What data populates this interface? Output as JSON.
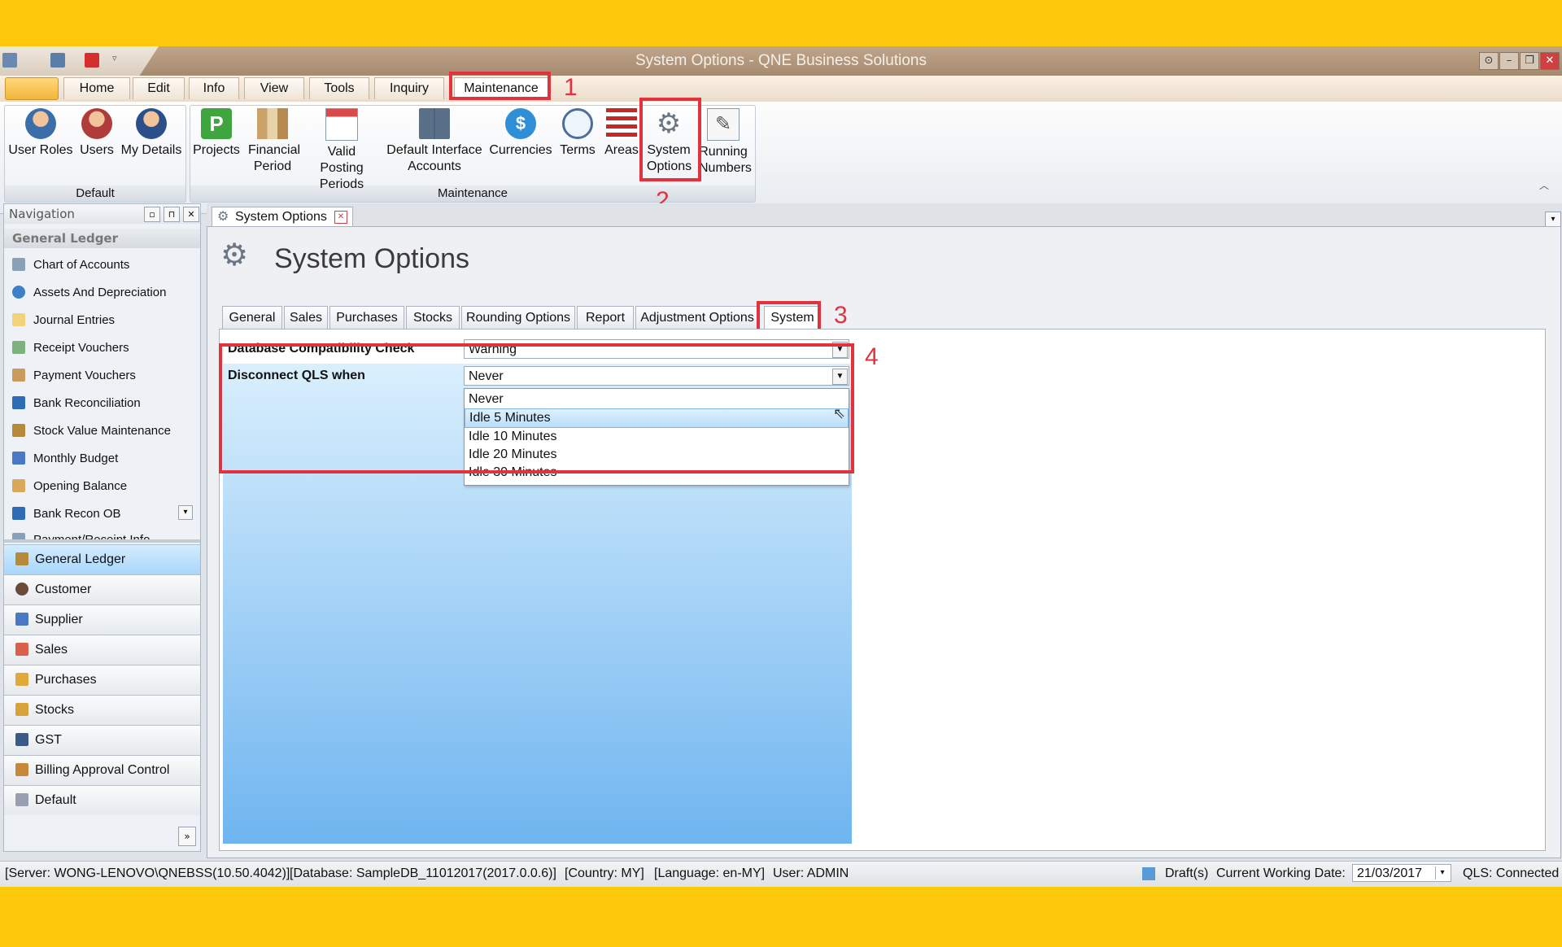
{
  "window": {
    "title": "System Options - QNE Business Solutions"
  },
  "menu": {
    "tabs": [
      "Home",
      "Edit",
      "Info",
      "View",
      "Tools",
      "Inquiry",
      "Maintenance"
    ],
    "active": "Maintenance"
  },
  "ribbon": {
    "default_group": {
      "label": "Default",
      "buttons": [
        "User Roles",
        "Users",
        "My Details"
      ]
    },
    "maintenance_group": {
      "label": "Maintenance",
      "buttons": [
        "Projects",
        "Financial Period",
        "Valid Posting Periods",
        "Default Interface Accounts",
        "Currencies",
        "Terms",
        "Areas",
        "System Options",
        "Running Numbers"
      ]
    }
  },
  "annotations": {
    "step1": "1",
    "step2": "2",
    "step3": "3",
    "step4": "4"
  },
  "navigation": {
    "title": "Navigation",
    "group": "General Ledger",
    "items": [
      "Chart of Accounts",
      "Assets And Depreciation",
      "Journal Entries",
      "Receipt Vouchers",
      "Payment Vouchers",
      "Bank Reconciliation",
      "Stock Value Maintenance",
      "Monthly Budget",
      "Opening Balance",
      "Bank Recon OB",
      "Payment/Receipt Info"
    ],
    "modules": [
      "General Ledger",
      "Customer",
      "Supplier",
      "Sales",
      "Purchases",
      "Stocks",
      "GST",
      "Billing Approval Control",
      "Default"
    ],
    "active_module": "General Ledger"
  },
  "document": {
    "tab_label": "System Options",
    "title": "System Options",
    "option_tabs": [
      "General",
      "Sales",
      "Purchases",
      "Stocks",
      "Rounding Options",
      "Report",
      "Adjustment Options",
      "System"
    ],
    "active_option_tab": "System",
    "fields": {
      "db_check": {
        "label": "Database Compatibility Check",
        "value": "Warning"
      },
      "disconnect": {
        "label": "Disconnect QLS when",
        "value": "Never"
      }
    },
    "dropdown_options": [
      "Never",
      "Idle 5 Minutes",
      "Idle 10 Minutes",
      "Idle 20 Minutes",
      "Idle 30 Minutes"
    ],
    "dropdown_highlighted": "Idle 5 Minutes"
  },
  "status": {
    "server": "[Server: WONG-LENOVO\\QNEBSS(10.50.4042)]",
    "database": "[Database: SampleDB_11012017(2017.0.0.6)]",
    "country": "[Country: MY]",
    "language": "[Language: en-MY]",
    "user": "User: ADMIN",
    "drafts": "Draft(s)",
    "working_date_label": "Current Working Date:",
    "working_date": "21/03/2017",
    "qls": "QLS: Connected"
  },
  "colors": {
    "accent": "#e2323d",
    "background": "#ffc90e",
    "highlight": "#b9defb"
  }
}
